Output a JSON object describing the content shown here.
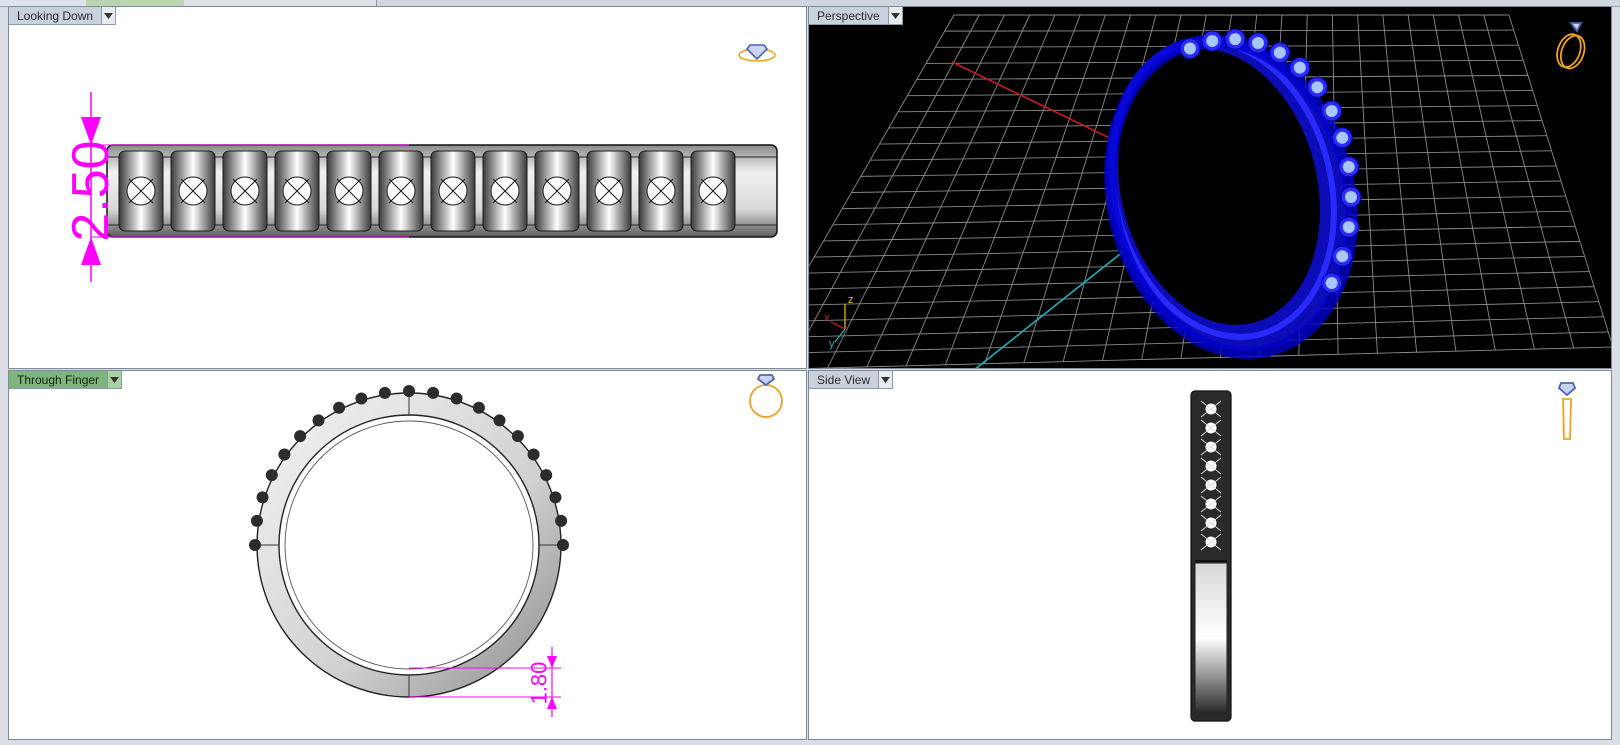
{
  "viewports": {
    "top_left": {
      "label": "Looking Down",
      "dimension": "2.50"
    },
    "top_right": {
      "label": "Perspective",
      "axes": {
        "x": "x",
        "y": "y",
        "z": "z"
      }
    },
    "bottom_left": {
      "label": "Through Finger",
      "dimension": "1.80"
    },
    "bottom_right": {
      "label": "Side View"
    }
  },
  "colors": {
    "dimension": "#ff00ff",
    "ring_blue": "#1414e6",
    "active_label": "#7fb57a",
    "grid": "#8a8a8a",
    "gem_icon": "#f4a21a"
  },
  "icons": {
    "dropdown": "chevron-down-icon",
    "view_cube": "ring-gem-icon"
  }
}
